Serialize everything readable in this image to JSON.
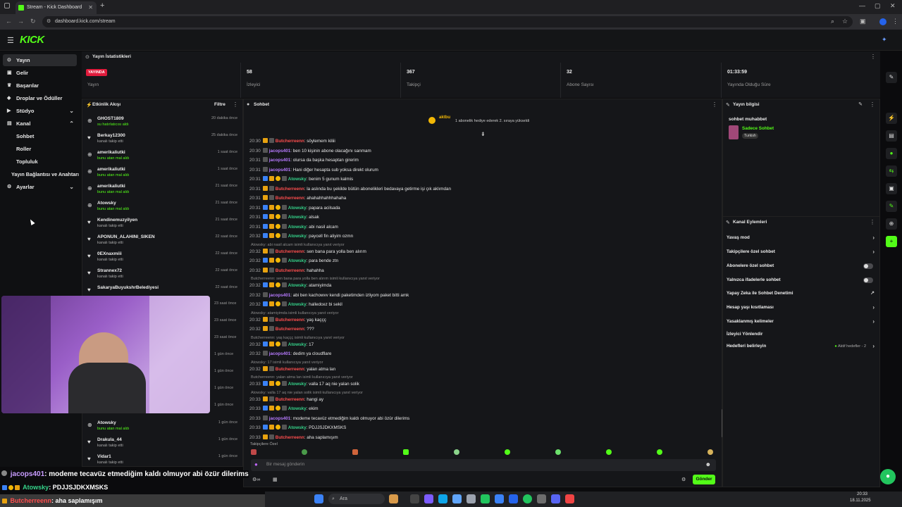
{
  "browser": {
    "tab_title": "Stream - Kick Dashboard",
    "new_tab": "+",
    "url": "dashboard.kick.com/stream",
    "win_min": "—",
    "win_max": "▢",
    "win_close": "✕"
  },
  "header": {
    "logo": "KICK"
  },
  "sidebar": {
    "items": [
      {
        "label": "Yayın",
        "icon": "((·))"
      },
      {
        "label": "Gelir",
        "icon": "▣"
      },
      {
        "label": "Başarılar",
        "icon": "🏆"
      },
      {
        "label": "Droplar ve Ödüller",
        "icon": "◆"
      },
      {
        "label": "Stüdyo",
        "icon": "▶"
      },
      {
        "label": "Kanal",
        "icon": "▤"
      }
    ],
    "sub": [
      "Sohbet",
      "Roller",
      "Topluluk",
      "Yayın Bağlantısı ve Anahtarı"
    ],
    "settings": "Ayarlar"
  },
  "stats": {
    "title": "Yayın İstatistikleri",
    "live_badge": "YAYINDA",
    "cells": [
      {
        "value": "",
        "label": "Yayın"
      },
      {
        "value": "58",
        "label": "İzleyici"
      },
      {
        "value": "367",
        "label": "Takipçi"
      },
      {
        "value": "32",
        "label": "Abone Sayısı"
      },
      {
        "value": "01:33:59",
        "label": "Yayında Olduğu Süre"
      }
    ]
  },
  "activity": {
    "title": "Etkinlik Akışı",
    "filter": "Filtre",
    "items": [
      {
        "name": "GHOST1809",
        "sub": "su hatırlatıcısı aldı",
        "time": "20 dakika önce",
        "green": true,
        "icon": "⊕"
      },
      {
        "name": "Berkay12300",
        "sub": "kanalı takip etti",
        "time": "25 dakika önce",
        "green": false,
        "icon": "♥"
      },
      {
        "name": "amerikaliutki",
        "sub": "bunu atan mal aldı",
        "time": "1 saat önce",
        "green": true,
        "icon": "⊕"
      },
      {
        "name": "amerikaliutki",
        "sub": "bunu atan mal aldı",
        "time": "1 saat önce",
        "green": true,
        "icon": "⊕"
      },
      {
        "name": "amerikaliutki",
        "sub": "bunu atan mal aldı",
        "time": "21 saat önce",
        "green": true,
        "icon": "⊕"
      },
      {
        "name": "Atowsky",
        "sub": "bunu atan mal aldı",
        "time": "21 saat önce",
        "green": true,
        "icon": "⊕"
      },
      {
        "name": "Kendinemuzyilyen",
        "sub": "kanalı takip etti",
        "time": "21 saat önce",
        "green": false,
        "icon": "♥"
      },
      {
        "name": "APONUN_ALAHINI_SIKEN",
        "sub": "kanalı takip etti",
        "time": "22 saat önce",
        "green": false,
        "icon": "♥"
      },
      {
        "name": "0EXnaxmiii",
        "sub": "kanalı takip etti",
        "time": "22 saat önce",
        "green": false,
        "icon": "♥"
      },
      {
        "name": "Strannex72",
        "sub": "kanalı takip etti",
        "time": "22 saat önce",
        "green": false,
        "icon": "♥"
      },
      {
        "name": "SakaryaBuyukshrBelediyesi",
        "sub": "",
        "time": "22 saat önce",
        "green": false,
        "icon": "♥"
      }
    ],
    "hidden_times": [
      "23 saat önce",
      "23 saat önce",
      "23 saat önce",
      "1 gün önce",
      "1 gün önce",
      "1 gün önce",
      "1 gün önce"
    ],
    "bottom_items": [
      {
        "name": "Atowsky",
        "sub": "bunu atan mal aldı",
        "time": "1 gün önce",
        "green": true,
        "icon": "⊕"
      },
      {
        "name": "Drakula_44",
        "sub": "kanalı takip etti",
        "time": "1 gün önce",
        "green": false,
        "icon": "♥"
      },
      {
        "name": "Vidar1",
        "sub": "kanalı takip etti",
        "time": "1 gün önce",
        "green": false,
        "icon": "♥"
      }
    ]
  },
  "chat": {
    "title": "Sohbet",
    "pinned_user": "aktbu",
    "pinned_text": "1 abonelik hediye ederek 2. sıraya yükseldi",
    "messages": [
      {
        "t": "20:30",
        "u": "Butcherreenn",
        "c": "#ff4e4e",
        "m": ": söylemem kiliii"
      },
      {
        "t": "20:30",
        "u": "jacops401",
        "c": "#b77aff",
        "m": ": ben 10 kişinin abone olacağını sanmam"
      },
      {
        "t": "20:31",
        "u": "jacops401",
        "c": "#b77aff",
        "m": ": olursa da başka hesaptan girerim"
      },
      {
        "t": "20:31",
        "u": "jacops401",
        "c": "#b77aff",
        "m": ": Hani diğer hesapta sub yoksa direkt olurum"
      },
      {
        "t": "20:31",
        "u": "Atowsky",
        "c": "#35d38a",
        "m": ": benim 5 gunum kalmis"
      },
      {
        "t": "20:31",
        "u": "Butcherreenn",
        "c": "#ff4e4e",
        "m": ": la aslında bu şekilde bütün abonelikleri bedavaya getirme işi çık aklımdan"
      },
      {
        "t": "20:31",
        "u": "Butcherreenn",
        "c": "#ff4e4e",
        "m": ": ahahahhahhhahaha"
      },
      {
        "t": "20:31",
        "u": "Atowsky",
        "c": "#35d38a",
        "m": ": papara acilsada"
      },
      {
        "t": "20:31",
        "u": "Atowsky",
        "c": "#35d38a",
        "m": ": alsak"
      },
      {
        "t": "20:31",
        "u": "Atowsky",
        "c": "#35d38a",
        "m": ": abi nasil alcam"
      },
      {
        "t": "20:32",
        "u": "Atowsky",
        "c": "#35d38a",
        "m": ": paycell fin aliyim ozmn"
      },
      {
        "t": "20:32",
        "u": "Butcherreenn",
        "c": "#ff4e4e",
        "m": ": sen bana para yolla ben alırım",
        "rep": "Atowsky: abi nasil alcam isimli kullanıcıya yanıt veriyor"
      },
      {
        "t": "20:32",
        "u": "Atowsky",
        "c": "#35d38a",
        "m": ": para bende ztn"
      },
      {
        "t": "20:32",
        "u": "Butcherreenn",
        "c": "#ff4e4e",
        "m": ": hahahha"
      },
      {
        "t": "20:32",
        "u": "Atowsky",
        "c": "#35d38a",
        "m": ": atamiyimda",
        "rep": "Butcherreenn: sen bana para yolla ben alırım isimli kullanıcıya yanıt veriyor"
      },
      {
        "t": "20:32",
        "u": "jacops401",
        "c": "#b77aff",
        "m": ": abi ben kachowvv kendi paketimden izliyom paket bitti amk"
      },
      {
        "t": "20:32",
        "u": "Atowsky",
        "c": "#35d38a",
        "m": ": halledcez bi sekil"
      },
      {
        "t": "20:32",
        "u": "Butcherreenn",
        "c": "#ff4e4e",
        "m": ": yaş kaççç",
        "rep": "Atowsky: atamiyimda isimli kullanıcıya yanıt veriyor"
      },
      {
        "t": "20:32",
        "u": "Butcherreenn",
        "c": "#ff4e4e",
        "m": ": ???"
      },
      {
        "t": "20:32",
        "u": "Atowsky",
        "c": "#35d38a",
        "m": ": 17",
        "rep": "Butcherreenn: yaş kaççç isimli kullanıcıya yanıt veriyor"
      },
      {
        "t": "20:32",
        "u": "jacops401",
        "c": "#b77aff",
        "m": ": dedim ya cloudflare"
      },
      {
        "t": "20:32",
        "u": "Butcherreenn",
        "c": "#ff4e4e",
        "m": ": yalan atma lan",
        "rep": "Atowsky: 17 isimli kullanıcıya yanıt veriyor"
      },
      {
        "t": "20:33",
        "u": "Atowsky",
        "c": "#35d38a",
        "m": ": valla 17 aq nie yalan solik",
        "rep": "Butcherreenn: yalan atma lan isimli kullanıcıya yanıt veriyor"
      },
      {
        "t": "20:33",
        "u": "Butcherreenn",
        "c": "#ff4e4e",
        "m": ": hangi ay",
        "rep": "Atowsky: valla 17 aq nie yalan solik isimli kullanıcıya yanıt veriyor"
      },
      {
        "t": "20:33",
        "u": "Atowsky",
        "c": "#35d38a",
        "m": ": ekim"
      },
      {
        "t": "20:33",
        "u": "jacops401",
        "c": "#b77aff",
        "m": ": modeme tecavüz etmediğim kaldı olmuyor abi özür dilerims"
      },
      {
        "t": "20:33",
        "u": "Atowsky",
        "c": "#35d38a",
        "m": ": PDJJSJDKXMSKS"
      },
      {
        "t": "20:33",
        "u": "Butcherreenn",
        "c": "#ff4e4e",
        "m": ": aha saplamışım"
      }
    ],
    "followers_only": "Takipçilere Özel",
    "input_placeholder": "Bir mesaj gönderin",
    "send_label": "Gönder"
  },
  "stream_info": {
    "title": "Yayın bilgisi",
    "stream_title": "sohbet muhabbet",
    "category": "Sadece Sohbet",
    "tag": "Turkish"
  },
  "channel_actions": {
    "title": "Kanal Eylemleri",
    "rows": [
      {
        "label": "Yavaş mod",
        "kind": "chev"
      },
      {
        "label": "Takipçilere özel sohbet",
        "kind": "chev"
      },
      {
        "label": "Abonelere özel sohbet",
        "kind": "toggle"
      },
      {
        "label": "Yalnızca ifadelerle sohbet",
        "kind": "toggle"
      },
      {
        "label": "Yapay Zeka ile Sohbet Denetimi",
        "kind": "ext"
      },
      {
        "label": "Hesap yaşı kısıtlaması",
        "kind": "chev"
      },
      {
        "label": "Yasaklanmış kelimeler",
        "kind": "chev"
      },
      {
        "label": "İzleyici Yönlendir",
        "kind": "none"
      },
      {
        "label": "Hedefleri belirleyin",
        "kind": "chev"
      }
    ],
    "goals_status": "Aktif hedefler - 2"
  },
  "overlay": {
    "line1_user": "jacops401",
    "line1_msg": ": modeme tecavüz etmediğim kaldı olmuyor abi özür dilerims",
    "line2_user": "Atowsky",
    "line2_msg": ": PDJJSJDKXMSKS",
    "line3_user": "Butcherreenn",
    "line3_msg": ": aha saplamışım"
  },
  "taskbar": {
    "search": "Ara",
    "time": "20:33",
    "date": "18.11.2025"
  },
  "colors": {
    "accent": "#53fc18",
    "live": "#e01b3c"
  }
}
